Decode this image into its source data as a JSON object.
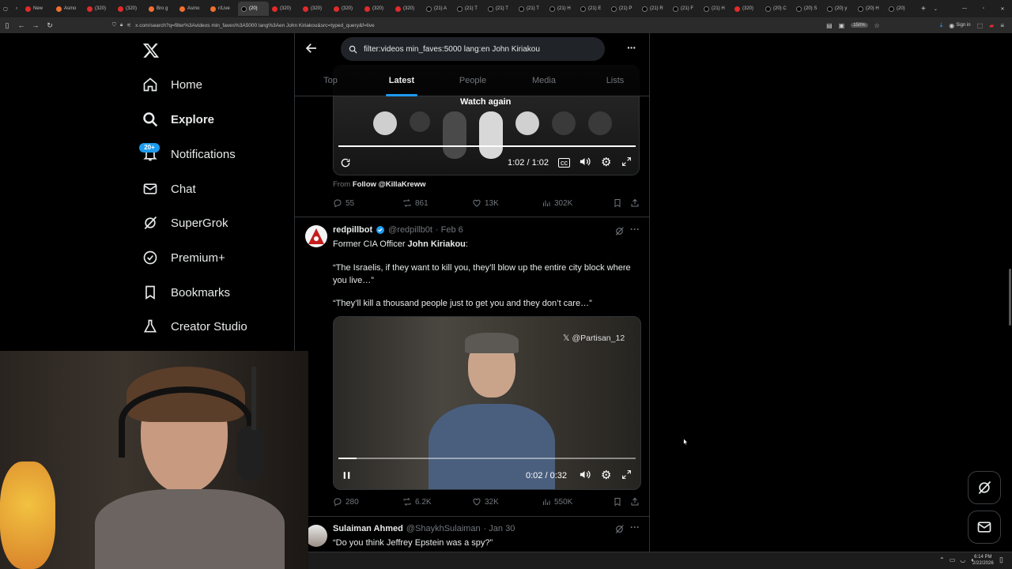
{
  "browser": {
    "tabs": [
      "New",
      "Asmo",
      "(320)",
      "(320)",
      "Bro g",
      "Asmo",
      "r/Live",
      "(20)",
      "(320)",
      "(320)",
      "(320)",
      "(320)",
      "(320)",
      "(21) A",
      "(21) T",
      "(21) T",
      "(21) T",
      "(21) H",
      "(21) E",
      "(21) P",
      "(21) R",
      "(21) F",
      "(21) H",
      "(320)",
      "(20) C",
      "(20) S",
      "(20) y",
      "(20) H",
      "(20)"
    ],
    "active_tab_index": 7,
    "url": "x.com/search?q=filter%3Avideos min_faves%3A5000 lang%3Aen John Kiriakou&src=typed_query&f=live",
    "zoom": "150%",
    "signin_label": "Sign in"
  },
  "sidebar": {
    "items": [
      {
        "label": "Home",
        "icon": "home-icon"
      },
      {
        "label": "Explore",
        "icon": "search-icon"
      },
      {
        "label": "Notifications",
        "icon": "bell-icon",
        "badge": "20+"
      },
      {
        "label": "Chat",
        "icon": "mail-icon"
      },
      {
        "label": "SuperGrok",
        "icon": "grok-icon"
      },
      {
        "label": "Premium+",
        "icon": "verified-icon"
      },
      {
        "label": "Bookmarks",
        "icon": "bookmark-icon"
      },
      {
        "label": "Creator Studio",
        "icon": "flask-icon"
      }
    ]
  },
  "search": {
    "query": "filter:videos min_faves:5000 lang:en John Kiriakou",
    "tabs": [
      "Top",
      "Latest",
      "People",
      "Media",
      "Lists"
    ],
    "active_tab": "Latest"
  },
  "tweet1": {
    "watch_again": "Watch again",
    "time": "1:02 / 1:02",
    "from_prefix": "From",
    "from_link": "Follow @KillaKreww",
    "replies": "55",
    "reposts": "861",
    "likes": "13K",
    "views": "302K"
  },
  "tweet2": {
    "name": "redpillbot",
    "handle": "@redpillb0t",
    "date": "· Feb 6",
    "line1_prefix": "Former CIA Officer ",
    "line1_bold": "John Kiriakou",
    "line1_suffix": ":",
    "quote1": "“The Israelis, if they want to kill you, they’ll blow up the entire city block where you live…”",
    "quote2": "“They’ll kill a thousand people just to get you and they don’t care…”",
    "watermark": "@Partisan_12",
    "video_time": "0:02 / 0:32",
    "progress": 0.06,
    "replies": "280",
    "reposts": "6.2K",
    "likes": "32K",
    "views": "550K"
  },
  "tweet3": {
    "name": "Sulaiman Ahmed",
    "handle": "@ShaykhSulaiman",
    "date": "· Jan 30",
    "text": "“Do you think Jeffrey Epstein was a spy?”"
  },
  "taskbar": {
    "time": "6:14 PM",
    "date": "2/22/2026"
  },
  "colors": {
    "accent": "#1d9bf0",
    "border": "#2f3336",
    "muted": "#71767b"
  }
}
